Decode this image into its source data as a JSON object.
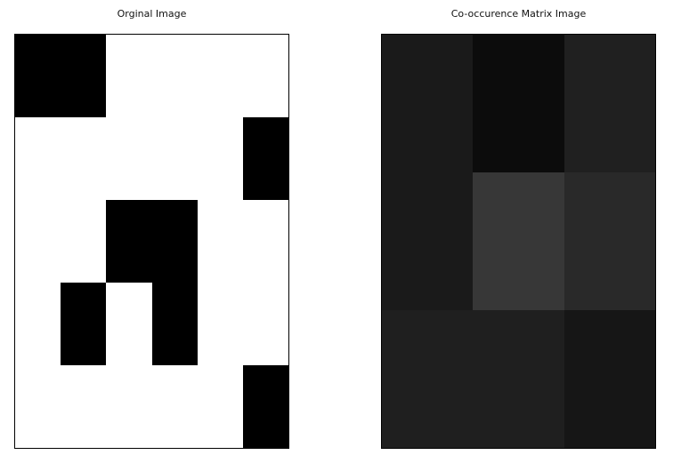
{
  "left_panel": {
    "title": "Orginal Image",
    "rows": 5,
    "cols": 6,
    "pixels": [
      [
        1,
        1,
        0,
        0,
        0,
        0
      ],
      [
        0,
        0,
        0,
        0,
        0,
        1
      ],
      [
        0,
        0,
        1,
        1,
        0,
        0
      ],
      [
        0,
        1,
        0,
        1,
        0,
        0
      ],
      [
        0,
        0,
        0,
        0,
        0,
        1
      ]
    ],
    "on_color": "#000000",
    "off_color": "#ffffff"
  },
  "right_panel": {
    "title": "Co-occurence Matrix Image",
    "rows": 3,
    "cols": 3,
    "gray_levels": [
      [
        "#1a1a1a",
        "#0c0c0c",
        "#202020"
      ],
      [
        "#1a1a1a",
        "#373737",
        "#292929"
      ],
      [
        "#1f1f1f",
        "#1f1f1f",
        "#161616"
      ]
    ]
  }
}
